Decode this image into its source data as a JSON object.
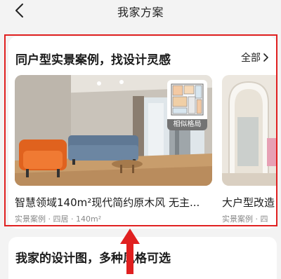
{
  "header": {
    "title": "我家方案"
  },
  "section": {
    "title": "同户型实景案例，找设计灵感",
    "all_label": "全部",
    "cases": [
      {
        "title": "智慧领域140m²现代简约原木风 无主...",
        "meta": "实景案例 · 四居 · 140m²",
        "badge": "相似格局"
      },
      {
        "title": "大户型改造",
        "meta": "实景案例 · 四"
      }
    ]
  },
  "next_section": {
    "title": "我家的设计图，多种风格可选"
  },
  "colors": {
    "highlight": "#e02020",
    "sofa_orange": "#e0621e",
    "sofa_blue": "#5f7894"
  }
}
